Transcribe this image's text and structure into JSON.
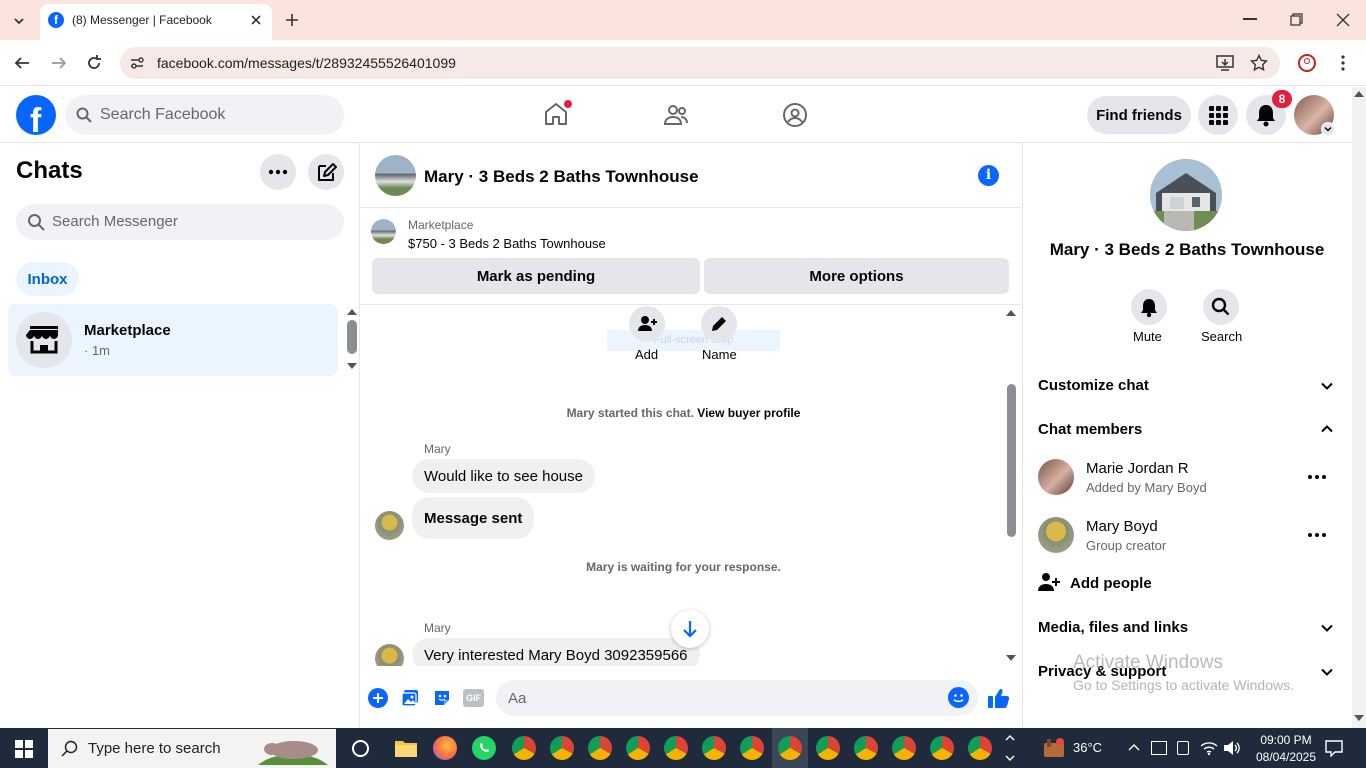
{
  "browser": {
    "tab_title": "(8) Messenger | Facebook",
    "url": "facebook.com/messages/t/28932455526401099"
  },
  "fb": {
    "search_placeholder": "Search Facebook",
    "find_friends": "Find friends",
    "notif_count": "8"
  },
  "chats": {
    "title": "Chats",
    "search_placeholder": "Search Messenger",
    "inbox_label": "Inbox",
    "items": [
      {
        "name": "Marketplace",
        "sub": "· 1m"
      }
    ]
  },
  "conversation": {
    "title": "Mary · 3 Beds 2 Baths Townhouse",
    "listing_source": "Marketplace",
    "listing_title": "$750 - 3 Beds 2 Baths Townhouse",
    "mark_pending": "Mark as pending",
    "more_options": "More options",
    "add_label": "Add",
    "name_label": "Name",
    "fullscreen_hint": "Full-screen Snip",
    "started_text": "Mary started this chat.",
    "view_profile": "View buyer profile",
    "waiting_text": "Mary is waiting for your response.",
    "messages": [
      {
        "sender": "Mary",
        "text": "Would like to see house"
      },
      {
        "sender": "",
        "text": "Message sent"
      },
      {
        "sender": "Mary",
        "text": "Very interested Mary Boyd 3092359566"
      }
    ],
    "composer_placeholder": "Aa"
  },
  "details": {
    "title": "Mary · 3 Beds 2 Baths Townhouse",
    "mute": "Mute",
    "search": "Search",
    "customize": "Customize chat",
    "members_title": "Chat members",
    "members": [
      {
        "name": "Marie Jordan R",
        "sub": "Added by Mary Boyd"
      },
      {
        "name": "Mary Boyd",
        "sub": "Group creator"
      }
    ],
    "add_people": "Add people",
    "media": "Media, files and links",
    "privacy": "Privacy & support",
    "watermark_1": "Activate Windows",
    "watermark_2": "Go to Settings to activate Windows."
  },
  "taskbar": {
    "search_placeholder": "Type here to search",
    "temperature": "36°C",
    "time": "09:00 PM",
    "date": "08/04/2025"
  },
  "colors": {
    "fb_blue": "#0866ff",
    "notif_red": "#e41e3f",
    "selected_chat": "#ebf5ff"
  }
}
